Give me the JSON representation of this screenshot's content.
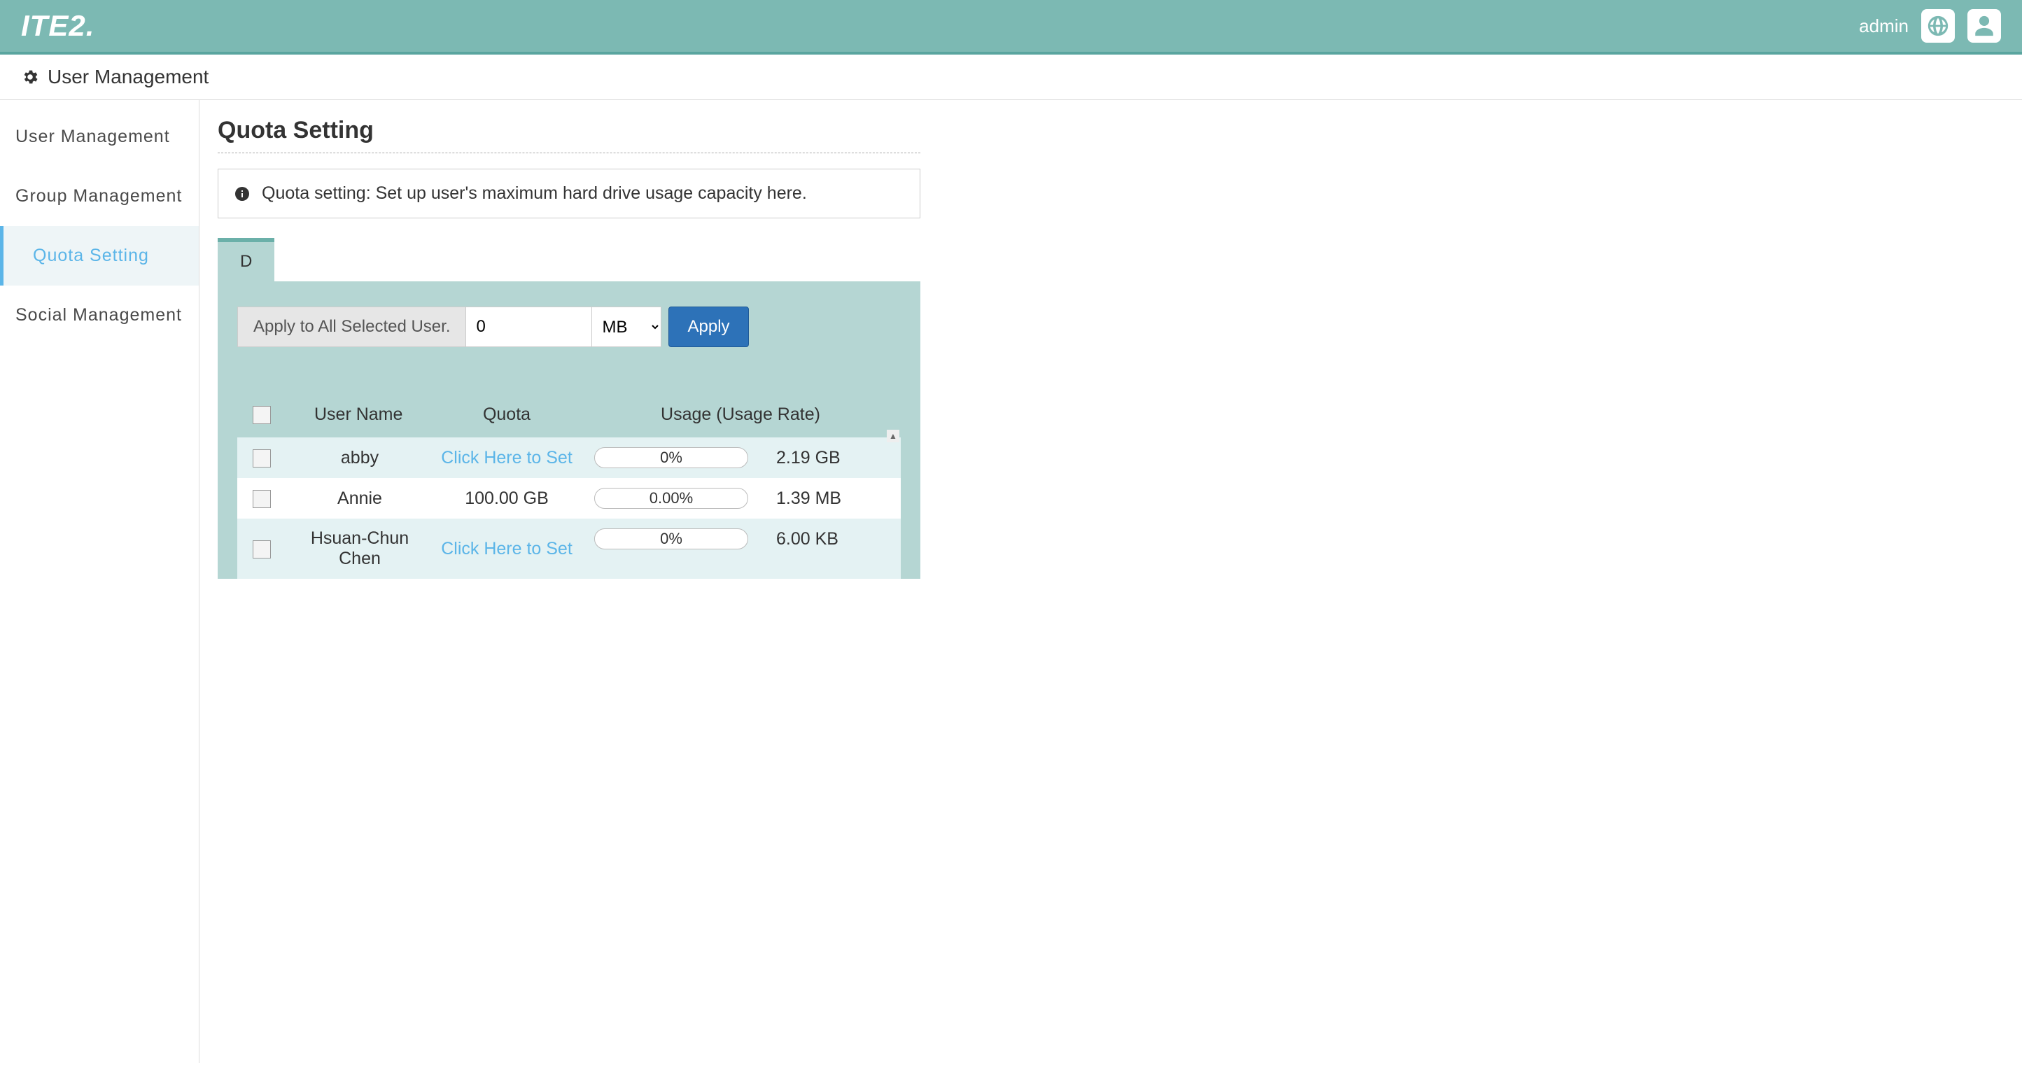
{
  "header": {
    "logo_text": "ITE2.",
    "username": "admin"
  },
  "subheader": {
    "title": "User Management"
  },
  "sidebar": {
    "items": [
      {
        "label": "User Management",
        "active": false
      },
      {
        "label": "Group Management",
        "active": false
      },
      {
        "label": "Quota Setting",
        "active": true
      },
      {
        "label": "Social Management",
        "active": false
      }
    ]
  },
  "page": {
    "title": "Quota Setting",
    "info": "Quota setting: Set up user's maximum hard drive usage capacity here.",
    "tab": "D",
    "apply_label": "Apply to All Selected User.",
    "apply_value": "0",
    "apply_unit": "MB",
    "apply_button": "Apply"
  },
  "table": {
    "headers": {
      "username": "User Name",
      "quota": "Quota",
      "usage": "Usage (Usage Rate)"
    },
    "rows": [
      {
        "username": "abby",
        "quota": "Click Here to Set",
        "quota_link": true,
        "rate": "0%",
        "usage": "2.19 GB"
      },
      {
        "username": "Annie",
        "quota": "100.00 GB",
        "quota_link": false,
        "rate": "0.00%",
        "usage": "1.39 MB"
      },
      {
        "username": "Hsuan-Chun Chen",
        "quota": "Click Here to Set",
        "quota_link": true,
        "rate": "0%",
        "usage": "6.00 KB"
      }
    ]
  }
}
